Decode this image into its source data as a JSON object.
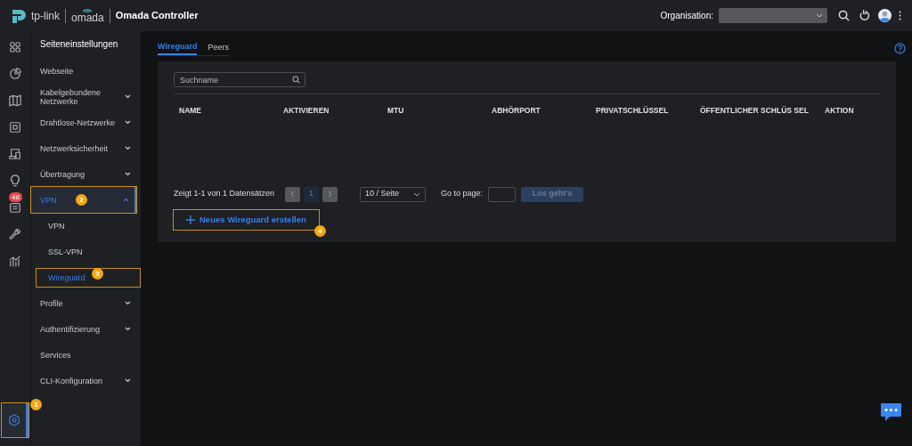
{
  "header": {
    "brand": "tp-link",
    "product": "omada",
    "title": "Omada Controller",
    "organisation_label": "Organisation:"
  },
  "rail": [
    {
      "selected": false
    },
    {
      "selected": false
    },
    {
      "selected": false
    },
    {
      "selected": false
    },
    {
      "selected": false
    },
    {
      "selected": false
    },
    {
      "selected": false,
      "badge": "48"
    },
    {
      "selected": false
    },
    {
      "selected": false
    }
  ],
  "rail_settings": {
    "selected": true,
    "callout": "1"
  },
  "sidebar": {
    "title": "Seiteneinstellungen",
    "items": [
      {
        "label": "Webseite",
        "selected": false
      },
      {
        "label": "Kabelgebundene Netzwerke",
        "selected": false,
        "expanded": false
      },
      {
        "label": "Drahtlose-Netzwerke",
        "selected": false,
        "expanded": false
      },
      {
        "label": "Netzwerksicherheit",
        "selected": false,
        "expanded": false
      },
      {
        "label": "Übertragung",
        "selected": false,
        "expanded": false
      },
      {
        "label": "VPN",
        "selected": true,
        "expanded": true,
        "callout": "2",
        "children": [
          {
            "label": "VPN",
            "selected": false
          },
          {
            "label": "SSL-VPN",
            "selected": false
          },
          {
            "label": "Wireguard",
            "selected": true,
            "callout": "3"
          }
        ]
      },
      {
        "label": "Profile",
        "selected": false,
        "expanded": false
      },
      {
        "label": "Authentifizierung",
        "selected": false,
        "expanded": false
      },
      {
        "label": "Services",
        "selected": false
      },
      {
        "label": "CLI-Konfiguration",
        "selected": false,
        "expanded": false
      }
    ]
  },
  "tabs": [
    {
      "label": "Wireguard",
      "selected": true
    },
    {
      "label": "Peers",
      "selected": false
    }
  ],
  "search": {
    "placeholder": "Suchname"
  },
  "table": {
    "columns": [
      "NAME",
      "AKTIVIEREN",
      "MTU",
      "ABHÖRPORT",
      "PRIVATSCHLÜSSEL",
      "ÖFFENTLICHER SCHLÜS SEL",
      "AKTION"
    ]
  },
  "pagination": {
    "summary": "Zeigt 1-1 von 1 Datensätzen",
    "pages": [
      {
        "label": "1",
        "selected": true
      }
    ],
    "page_size": "10 / Seite",
    "goto_label": "Go to page:",
    "go_button": {
      "label": "Los geht's",
      "disabled": true
    }
  },
  "create_button": {
    "label": "Neues Wireguard erstellen",
    "callout": "4"
  }
}
